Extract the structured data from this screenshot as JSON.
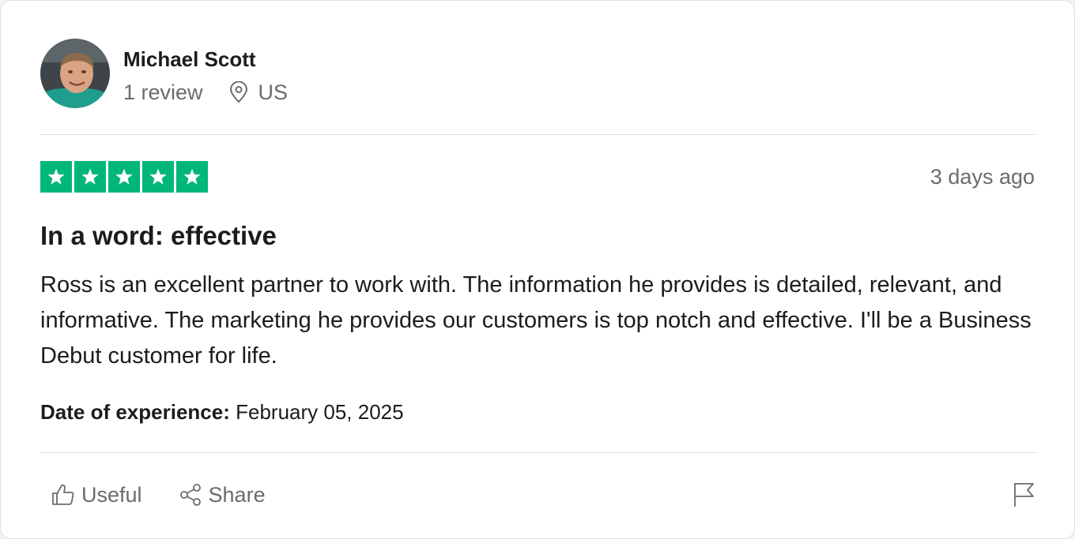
{
  "consumer": {
    "name": "Michael Scott",
    "reviews": "1 review",
    "location": "US",
    "avatar_icon": "avatar-photo"
  },
  "review": {
    "rating": 5,
    "rating_max": 5,
    "star_color": "#00b67a",
    "date": "3 days ago",
    "title": "In a word: effective",
    "body": "Ross is an excellent partner to work with. The information he provides is detailed, relevant, and informative. The marketing he provides our customers is top notch and effective. I'll be a Business Debut customer for life.",
    "experience_label": "Date of experience:",
    "experience_date": "February 05, 2025"
  },
  "actions": {
    "useful_label": "Useful",
    "useful_icon": "thumbs-up-icon",
    "share_label": "Share",
    "share_icon": "share-icon",
    "report_icon": "flag-icon"
  },
  "colors": {
    "text_primary": "#1c1c1c",
    "text_secondary": "#6b6b6b",
    "divider": "#dedede"
  }
}
